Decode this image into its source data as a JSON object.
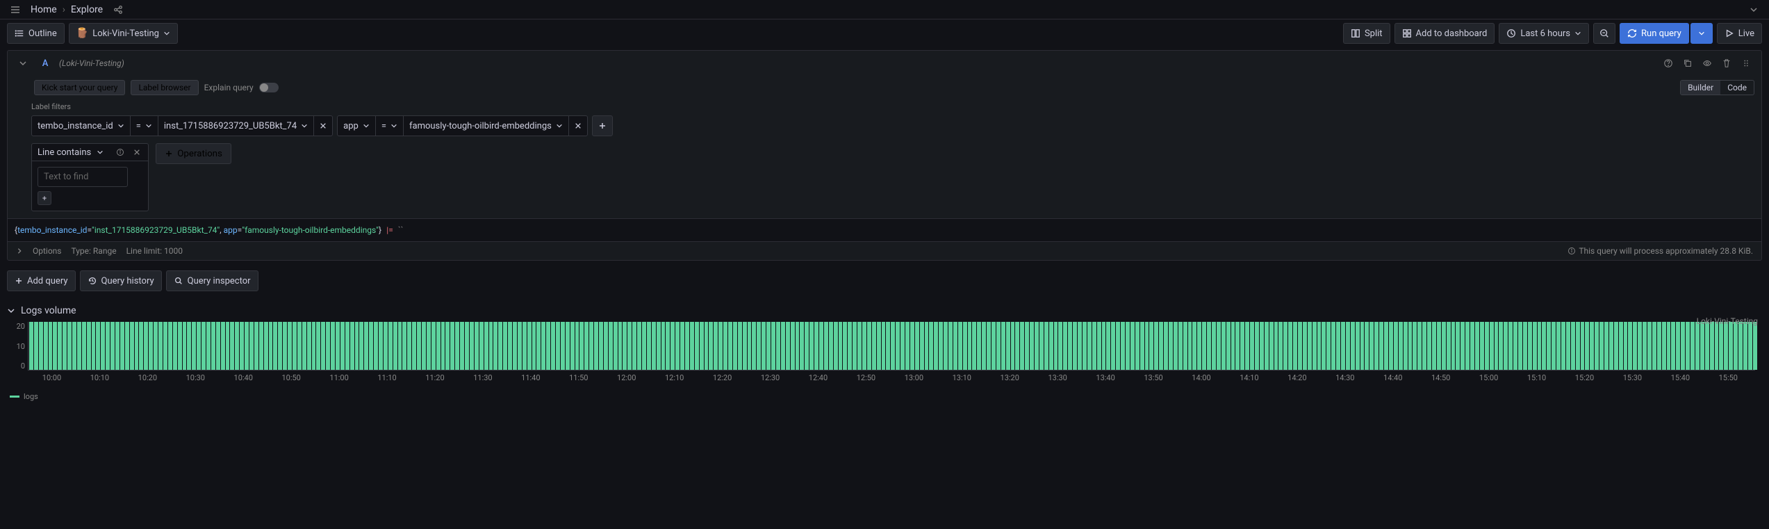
{
  "breadcrumb": {
    "home": "Home",
    "explore": "Explore"
  },
  "toolbar": {
    "outline": "Outline",
    "datasource_icon": "🪵",
    "datasource": "Loki-Vini-Testing",
    "split": "Split",
    "add_dashboard": "Add to dashboard",
    "timerange": "Last 6 hours",
    "run_query": "Run query",
    "live": "Live"
  },
  "query": {
    "letter": "A",
    "name": "(Loki-Vini-Testing)",
    "kick_start": "Kick start your query",
    "label_browser": "Label browser",
    "explain": "Explain query",
    "builder": "Builder",
    "code": "Code",
    "label_filters": "Label filters",
    "filter1_key": "tembo_instance_id",
    "filter1_op": "=",
    "filter1_val": "inst_1715886923729_UB5Bkt_74",
    "filter2_key": "app",
    "filter2_op": "=",
    "filter2_val": "famously-tough-oilbird-embeddings",
    "line_contains": "Line contains",
    "text_placeholder": "Text to find",
    "operations": "Operations",
    "options": "Options",
    "type": "Type: Range",
    "line_limit": "Line limit: 1000",
    "cost_msg": "This query will process approximately 28.8 KiB."
  },
  "code_tokens": {
    "k1": "tembo_instance_id",
    "v1": "\"inst_1715886923729_UB5Bkt_74\"",
    "k2": "app",
    "v2": "\"famously-tough-oilbird-embeddings\"",
    "pipe": "|=",
    "bt": "``"
  },
  "buttons": {
    "add_query": "Add query",
    "query_history": "Query history",
    "query_inspector": "Query inspector"
  },
  "logs": {
    "title": "Logs volume",
    "series_label": "Loki-Vini-Testing",
    "legend": "logs"
  },
  "chart_data": {
    "type": "bar",
    "ylabel": "",
    "ylim": [
      0,
      20
    ],
    "yticks": [
      20,
      10,
      0
    ],
    "categories": [
      "10:00",
      "10:10",
      "10:20",
      "10:30",
      "10:40",
      "10:50",
      "11:00",
      "11:10",
      "11:20",
      "11:30",
      "11:40",
      "11:50",
      "12:00",
      "12:10",
      "12:20",
      "12:30",
      "12:40",
      "12:50",
      "13:00",
      "13:10",
      "13:20",
      "13:30",
      "13:40",
      "13:50",
      "14:00",
      "14:10",
      "14:20",
      "14:30",
      "14:40",
      "14:50",
      "15:00",
      "15:10",
      "15:20",
      "15:30",
      "15:40",
      "15:50"
    ],
    "series": [
      {
        "name": "logs",
        "color": "#5dd39e",
        "values": [
          20,
          20,
          20,
          20,
          20,
          20,
          20,
          20,
          20,
          20,
          20,
          20,
          20,
          20,
          20,
          20,
          20,
          20,
          20,
          20,
          20,
          20,
          20,
          20,
          20,
          20,
          20,
          20,
          20,
          20,
          20,
          20,
          20,
          20,
          20,
          20,
          20,
          20,
          20,
          20,
          20,
          20,
          20,
          20,
          20,
          20,
          20,
          20,
          20,
          20,
          20,
          20,
          20,
          20,
          20,
          20,
          20,
          20,
          20,
          20,
          20,
          20,
          20,
          20,
          20,
          20,
          20,
          20,
          20,
          20,
          20,
          20,
          20,
          20,
          20,
          20,
          20,
          20,
          20,
          20,
          20,
          20,
          20,
          20,
          20,
          20,
          20,
          20,
          20,
          20,
          20,
          20,
          20,
          20,
          20,
          20,
          20,
          20,
          20,
          20,
          20,
          20,
          20,
          20,
          20,
          20,
          20,
          20,
          20,
          20,
          20,
          20,
          20,
          20,
          20,
          20,
          20,
          20,
          20,
          20,
          20,
          20,
          20,
          20,
          20,
          20,
          20,
          20,
          20,
          20,
          20,
          20,
          20,
          20,
          20,
          20,
          20,
          20,
          20,
          20,
          20,
          20,
          20,
          20,
          20,
          20,
          20,
          20,
          20,
          20,
          20,
          20,
          20,
          20,
          20,
          20,
          20,
          20,
          20,
          20,
          20,
          20,
          20,
          20,
          20,
          20,
          20,
          20,
          20,
          20,
          20,
          20,
          20,
          20,
          20,
          20,
          20,
          20,
          20,
          20,
          20,
          20,
          20,
          20,
          20,
          20,
          20,
          20,
          20,
          20,
          20,
          20,
          20,
          20,
          20,
          20,
          20,
          20,
          20,
          20,
          20,
          20,
          20,
          20,
          20,
          20,
          20,
          20,
          20,
          20,
          20,
          20,
          20,
          20,
          20,
          20,
          20,
          20,
          20,
          20,
          20,
          20,
          20,
          20,
          20,
          20,
          20,
          20,
          20,
          20,
          20,
          20,
          20,
          20,
          20,
          20,
          20,
          20,
          20,
          20,
          20,
          20,
          20,
          20,
          20,
          20,
          20,
          20,
          20,
          20,
          20,
          20,
          20,
          20,
          20,
          20,
          20,
          20,
          20,
          20,
          20,
          20,
          20,
          20,
          20,
          20,
          20,
          20,
          20,
          20,
          20,
          20,
          20,
          20,
          20,
          20,
          20,
          20,
          20,
          20,
          20,
          20,
          20,
          20,
          20,
          20,
          20,
          20,
          20,
          20,
          20,
          20,
          20,
          20,
          20,
          20,
          20,
          20,
          20,
          20,
          20,
          20,
          20,
          20,
          20,
          20,
          20,
          20,
          20,
          20,
          20,
          20,
          20,
          20,
          20,
          20,
          20,
          20,
          20,
          20,
          20,
          20,
          20,
          20,
          20,
          20,
          20,
          20,
          20,
          20,
          20,
          20,
          20,
          20,
          20,
          20,
          20,
          20,
          20,
          20,
          20,
          20,
          20,
          20,
          20,
          20,
          20,
          20,
          20,
          20,
          20,
          20,
          20,
          20,
          20,
          20,
          20,
          20,
          20,
          20,
          20
        ]
      }
    ]
  }
}
